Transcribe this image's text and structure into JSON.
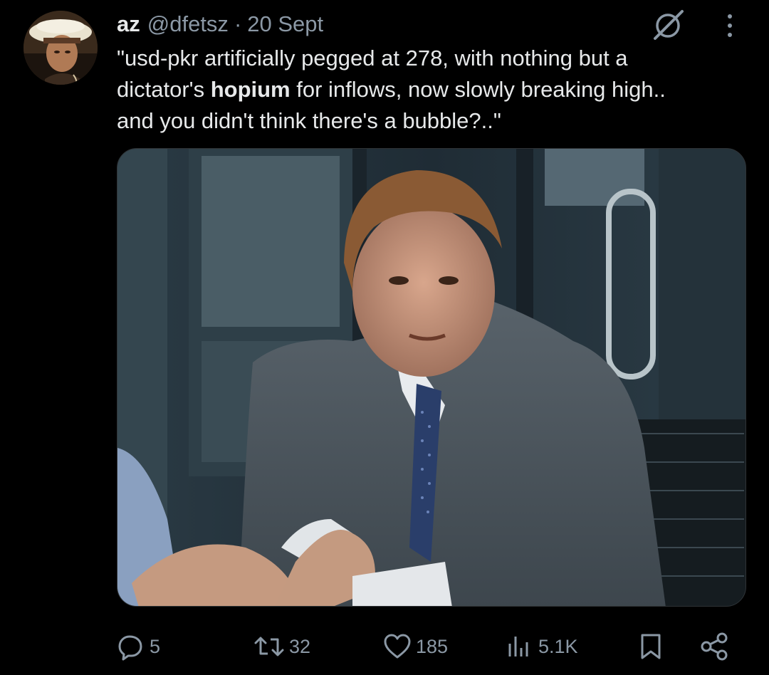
{
  "author": {
    "display_name": "az",
    "handle": "@dfetsz",
    "separator": "·",
    "date": "20 Sept"
  },
  "tweet": {
    "line1": "\"usd-pkr artificially pegged at 278, with nothing but a",
    "line2_before": "dictator's ",
    "line2_bold": "hopium",
    "line2_after": " for inflows, now slowly breaking high..",
    "line3": "and you didn't think there's a bubble?..\""
  },
  "actions": {
    "replies": "5",
    "reposts": "32",
    "likes": "185",
    "views": "5.1K"
  },
  "icons": {
    "grok": "grok-icon",
    "more": "more-options-icon",
    "reply": "reply-icon",
    "repost": "repost-icon",
    "like": "heart-icon",
    "views": "views-icon",
    "bookmark": "bookmark-icon",
    "share": "share-icon"
  },
  "colors": {
    "background": "#000000",
    "text_primary": "#e7e9ea",
    "text_secondary": "#8b98a5"
  }
}
